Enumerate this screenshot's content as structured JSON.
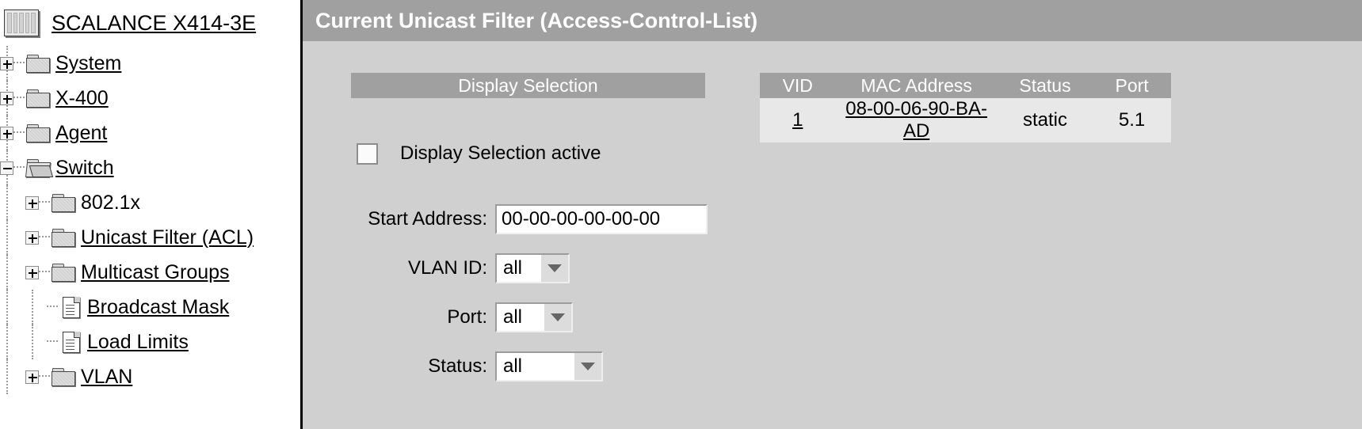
{
  "sidebar": {
    "root": {
      "label": "SCALANCE X414-3E",
      "icon": "switch-device-icon"
    },
    "items": [
      {
        "label": "System",
        "icon": "folder-closed-icon",
        "expander": "plus",
        "level": 1
      },
      {
        "label": "X-400",
        "icon": "folder-closed-icon",
        "expander": "plus",
        "level": 1
      },
      {
        "label": "Agent",
        "icon": "folder-closed-icon",
        "expander": "plus",
        "level": 1
      },
      {
        "label": "Switch",
        "icon": "folder-open-icon",
        "expander": "minus",
        "level": 1
      },
      {
        "label": "802.1x",
        "icon": "folder-closed-icon",
        "expander": "plus",
        "level": 2
      },
      {
        "label": "Unicast Filter (ACL)",
        "icon": "folder-closed-icon",
        "expander": "plus",
        "level": 2
      },
      {
        "label": "Multicast Groups",
        "icon": "folder-closed-icon",
        "expander": "plus",
        "level": 2
      },
      {
        "label": "Broadcast Mask",
        "icon": "document-icon",
        "expander": "none",
        "level": 2
      },
      {
        "label": "Load Limits",
        "icon": "document-icon",
        "expander": "none",
        "level": 2
      },
      {
        "label": "VLAN",
        "icon": "folder-closed-icon",
        "expander": "plus",
        "level": 2
      }
    ]
  },
  "header": {
    "title": "Current Unicast Filter (Access-Control-List)"
  },
  "panel": {
    "heading": "Display Selection",
    "checkbox": {
      "label": "Display Selection active",
      "checked": false
    },
    "fields": [
      {
        "label": "Start Address:",
        "value": "00-00-00-00-00-00",
        "type": "text"
      },
      {
        "label": "VLAN ID:",
        "value": "all",
        "type": "select"
      },
      {
        "label": "Port:",
        "value": "all",
        "type": "select"
      },
      {
        "label": "Status:",
        "value": "all",
        "type": "select"
      }
    ]
  },
  "table": {
    "columns": [
      "VID",
      "MAC Address",
      "Status",
      "Port"
    ],
    "rows": [
      {
        "vid": "1",
        "mac": "08-00-06-90-BA-AD",
        "status": "static",
        "port": "5.1"
      }
    ]
  },
  "colors": {
    "title_bar": "#a0a0a0",
    "content_bg": "#d0d0d0",
    "table_row_bg": "#e8e8e8",
    "sidebar_bg": "#ffffff"
  }
}
